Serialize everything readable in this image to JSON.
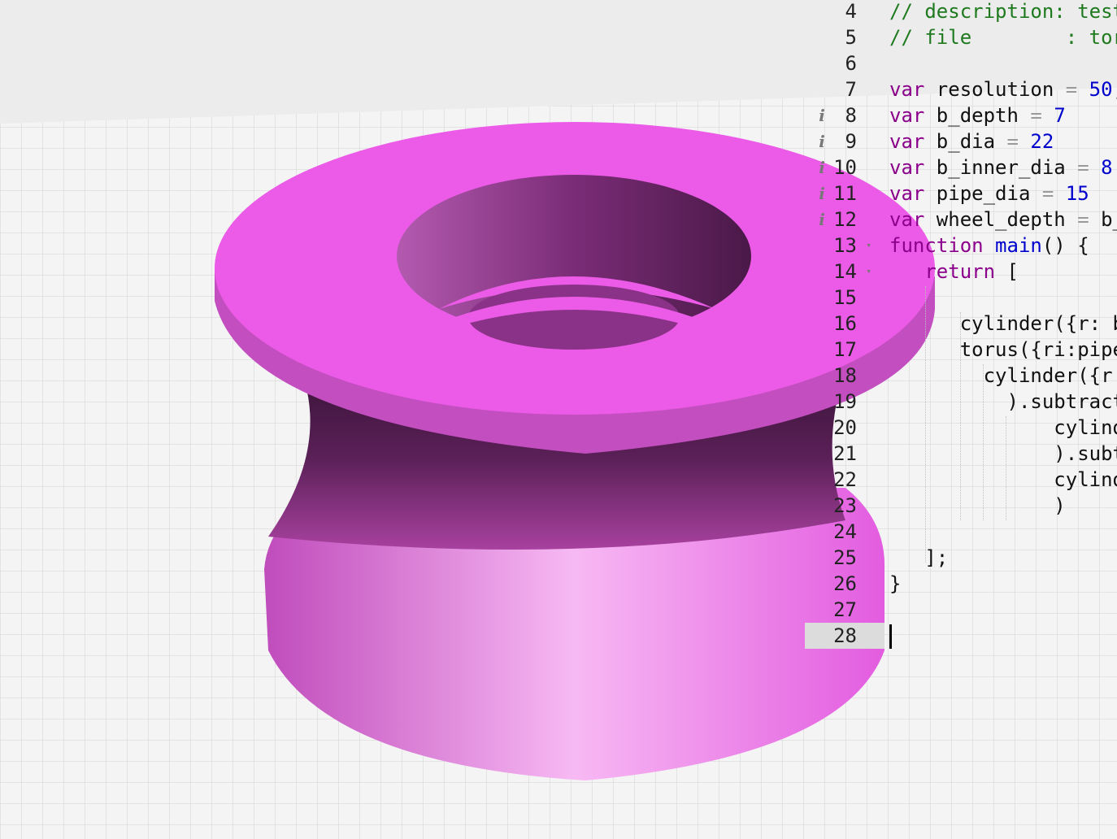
{
  "colors": {
    "keyword": "#8b008b",
    "number": "#0000cc",
    "comment": "#1f7a1f",
    "operator": "#9a9a9a",
    "plain": "#111111",
    "model_top": "#ec5be7"
  },
  "editor": {
    "active_line": "28",
    "lines": [
      {
        "n": "4",
        "info": false,
        "fold": false,
        "tokens": [
          {
            "t": "// description: test",
            "c": "comment"
          }
        ]
      },
      {
        "n": "5",
        "info": false,
        "fold": false,
        "tokens": [
          {
            "t": "// file        : toru",
            "c": "comment"
          }
        ]
      },
      {
        "n": "6",
        "info": false,
        "fold": false,
        "tokens": []
      },
      {
        "n": "7",
        "info": false,
        "fold": false,
        "tokens": [
          {
            "t": "var",
            "c": "keyword"
          },
          {
            "t": " resolution ",
            "c": "plain"
          },
          {
            "t": "=",
            "c": "operator"
          },
          {
            "t": " ",
            "c": "plain"
          },
          {
            "t": "50",
            "c": "number"
          },
          {
            "t": ";",
            "c": "plain"
          }
        ]
      },
      {
        "n": "8",
        "info": true,
        "fold": false,
        "tokens": [
          {
            "t": "var",
            "c": "keyword"
          },
          {
            "t": " b_depth ",
            "c": "plain"
          },
          {
            "t": "=",
            "c": "operator"
          },
          {
            "t": " ",
            "c": "plain"
          },
          {
            "t": "7",
            "c": "number"
          }
        ]
      },
      {
        "n": "9",
        "info": true,
        "fold": false,
        "tokens": [
          {
            "t": "var",
            "c": "keyword"
          },
          {
            "t": " b_dia ",
            "c": "plain"
          },
          {
            "t": "=",
            "c": "operator"
          },
          {
            "t": " ",
            "c": "plain"
          },
          {
            "t": "22",
            "c": "number"
          }
        ]
      },
      {
        "n": "10",
        "info": true,
        "fold": false,
        "tokens": [
          {
            "t": "var",
            "c": "keyword"
          },
          {
            "t": " b_inner_dia ",
            "c": "plain"
          },
          {
            "t": "=",
            "c": "operator"
          },
          {
            "t": " ",
            "c": "plain"
          },
          {
            "t": "8",
            "c": "number"
          }
        ]
      },
      {
        "n": "11",
        "info": true,
        "fold": false,
        "tokens": [
          {
            "t": "var",
            "c": "keyword"
          },
          {
            "t": " pipe_dia ",
            "c": "plain"
          },
          {
            "t": "=",
            "c": "operator"
          },
          {
            "t": " ",
            "c": "plain"
          },
          {
            "t": "15",
            "c": "number"
          }
        ]
      },
      {
        "n": "12",
        "info": true,
        "fold": false,
        "tokens": [
          {
            "t": "var",
            "c": "keyword"
          },
          {
            "t": " wheel_depth ",
            "c": "plain"
          },
          {
            "t": "=",
            "c": "operator"
          },
          {
            "t": " b_",
            "c": "plain"
          }
        ]
      },
      {
        "n": "13",
        "info": false,
        "fold": true,
        "tokens": [
          {
            "t": "function",
            "c": "keyword"
          },
          {
            "t": " ",
            "c": "plain"
          },
          {
            "t": "main",
            "c": "number"
          },
          {
            "t": "() {",
            "c": "plain"
          }
        ]
      },
      {
        "n": "14",
        "info": false,
        "fold": true,
        "tokens": [
          {
            "t": "   ",
            "c": "plain"
          },
          {
            "t": "return",
            "c": "keyword"
          },
          {
            "t": " [",
            "c": "plain"
          }
        ]
      },
      {
        "n": "15",
        "info": false,
        "fold": false,
        "tokens": []
      },
      {
        "n": "16",
        "info": false,
        "fold": false,
        "tokens": [
          {
            "t": "      cylinder({r: b",
            "c": "plain"
          }
        ]
      },
      {
        "n": "17",
        "info": false,
        "fold": false,
        "tokens": [
          {
            "t": "      torus({ri:pipe",
            "c": "plain"
          }
        ]
      },
      {
        "n": "18",
        "info": false,
        "fold": false,
        "tokens": [
          {
            "t": "        cylinder({r:",
            "c": "plain"
          }
        ]
      },
      {
        "n": "19",
        "info": false,
        "fold": false,
        "tokens": [
          {
            "t": "          ).subtract",
            "c": "plain"
          }
        ]
      },
      {
        "n": "20",
        "info": false,
        "fold": false,
        "tokens": [
          {
            "t": "              cylind",
            "c": "plain"
          }
        ]
      },
      {
        "n": "21",
        "info": false,
        "fold": false,
        "tokens": [
          {
            "t": "              ).subt",
            "c": "plain"
          }
        ]
      },
      {
        "n": "22",
        "info": false,
        "fold": false,
        "tokens": [
          {
            "t": "              cylind",
            "c": "plain"
          }
        ]
      },
      {
        "n": "23",
        "info": false,
        "fold": false,
        "tokens": [
          {
            "t": "              )",
            "c": "plain"
          }
        ]
      },
      {
        "n": "24",
        "info": false,
        "fold": false,
        "tokens": []
      },
      {
        "n": "25",
        "info": false,
        "fold": false,
        "tokens": [
          {
            "t": "   ];",
            "c": "plain"
          }
        ]
      },
      {
        "n": "26",
        "info": false,
        "fold": false,
        "tokens": [
          {
            "t": "}",
            "c": "plain"
          }
        ]
      },
      {
        "n": "27",
        "info": false,
        "fold": false,
        "tokens": []
      },
      {
        "n": "28",
        "info": false,
        "fold": false,
        "tokens": []
      }
    ]
  }
}
